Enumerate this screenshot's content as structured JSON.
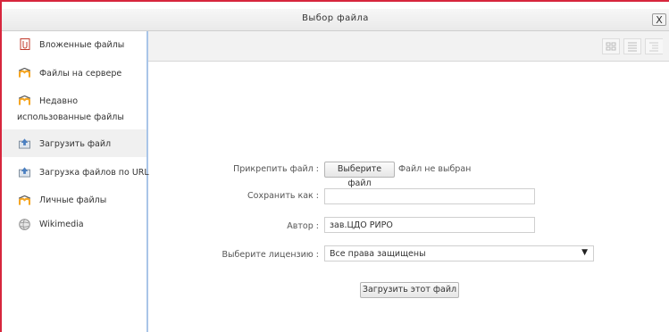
{
  "dialog": {
    "title": "Выбор файла",
    "close_label": "X"
  },
  "sidebar": {
    "items": [
      {
        "label": "Вложенные файлы",
        "icon": "attachment-icon"
      },
      {
        "label": "Файлы на сервере",
        "icon": "moodle-icon"
      },
      {
        "label": "Недавно",
        "label_line2": "использованные файлы",
        "icon": "moodle-icon"
      },
      {
        "label": "Загрузить файл",
        "icon": "upload-icon"
      },
      {
        "label": "Загрузка файлов по URL",
        "icon": "upload-icon"
      },
      {
        "label": "Личные файлы",
        "icon": "moodle-icon"
      },
      {
        "label": "Wikimedia",
        "icon": "wikipedia-globe-icon"
      }
    ]
  },
  "toolbar": {
    "view_modes": [
      "icons-view-icon",
      "list-view-icon",
      "tree-view-icon"
    ]
  },
  "form": {
    "attach_label": "Прикрепить файл :",
    "choose_button": "Выберите файл",
    "no_file_text": "Файл не выбран",
    "save_as_label": "Сохранить как :",
    "save_as_value": "",
    "author_label": "Автор :",
    "author_value": "зав.ЦДО РИРО",
    "license_label": "Выберите лицензию :",
    "license_value": "Все права защищены",
    "upload_button": "Загрузить этот файл"
  },
  "colors": {
    "accent_border": "#d7263d",
    "sidebar_divider": "#a9c5e8"
  }
}
